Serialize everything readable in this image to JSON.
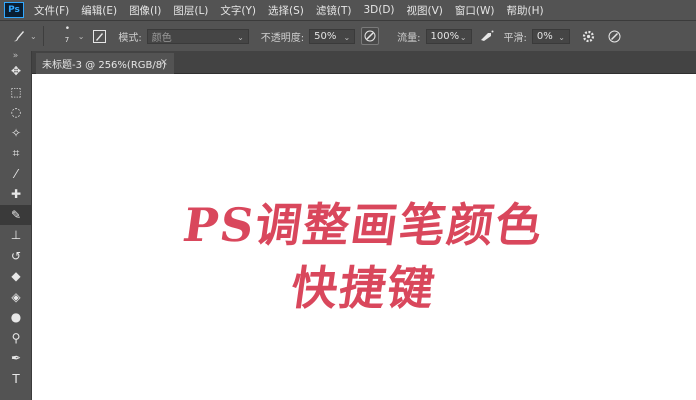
{
  "app": {
    "logo_text": "Ps"
  },
  "menu": [
    "文件(F)",
    "编辑(E)",
    "图像(I)",
    "图层(L)",
    "文字(Y)",
    "选择(S)",
    "滤镜(T)",
    "3D(D)",
    "视图(V)",
    "窗口(W)",
    "帮助(H)"
  ],
  "options": {
    "brush_size": "7",
    "mode_label": "模式:",
    "mode_value": "颜色",
    "opacity_label": "不透明度:",
    "opacity_value": "50%",
    "flow_label": "流量:",
    "flow_value": "100%",
    "smoothing_label": "平滑:",
    "smoothing_value": "0%"
  },
  "tab": {
    "title": "未标题-3 @ 256%(RGB/8)",
    "close": "×"
  },
  "canvas": {
    "line1": "PS调整画笔颜色",
    "line2": "快捷键"
  },
  "tools": [
    {
      "name": "move-tool-icon",
      "glyph": "✥"
    },
    {
      "name": "marquee-tool-icon",
      "glyph": "⬚"
    },
    {
      "name": "lasso-tool-icon",
      "glyph": "◌"
    },
    {
      "name": "magic-wand-tool-icon",
      "glyph": "✧"
    },
    {
      "name": "crop-tool-icon",
      "glyph": "⌗"
    },
    {
      "name": "eyedropper-tool-icon",
      "glyph": "⁄"
    },
    {
      "name": "healing-brush-tool-icon",
      "glyph": "✚"
    },
    {
      "name": "brush-tool-icon",
      "glyph": "✎"
    },
    {
      "name": "clone-stamp-tool-icon",
      "glyph": "⊥"
    },
    {
      "name": "history-brush-tool-icon",
      "glyph": "↺"
    },
    {
      "name": "eraser-tool-icon",
      "glyph": "◆"
    },
    {
      "name": "paint-bucket-tool-icon",
      "glyph": "◈"
    },
    {
      "name": "blur-tool-icon",
      "glyph": "●"
    },
    {
      "name": "dodge-tool-icon",
      "glyph": "⚲"
    },
    {
      "name": "pen-tool-icon",
      "glyph": "✒"
    },
    {
      "name": "type-tool-icon",
      "glyph": "T"
    }
  ],
  "colors": {
    "chrome": "#535353",
    "canvas": "#ffffff",
    "art_red": "#d9475c"
  }
}
